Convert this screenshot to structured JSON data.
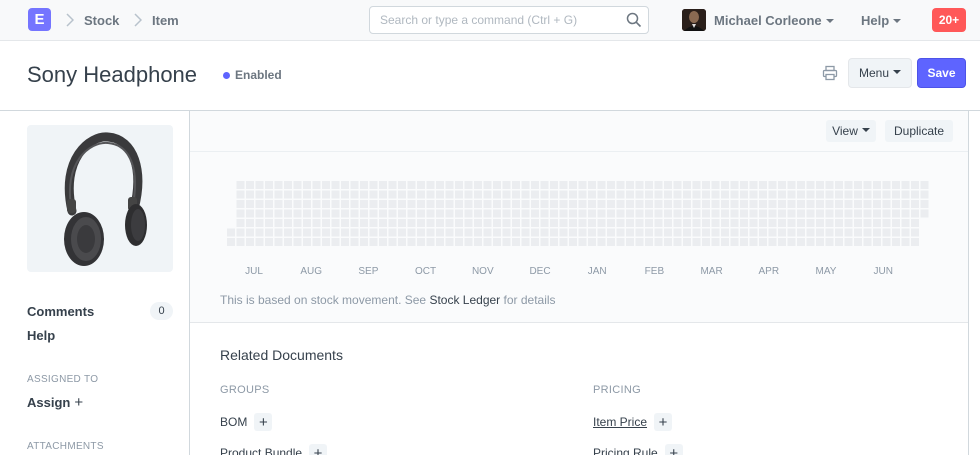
{
  "navbar": {
    "logo_letter": "E",
    "breadcrumbs": [
      "Stock",
      "Item"
    ],
    "search_placeholder": "Search or type a command (Ctrl + G)",
    "user_name": "Michael Corleone",
    "help_label": "Help",
    "notification_count": "20+"
  },
  "page": {
    "title": "Sony Headphone",
    "status": "Enabled",
    "status_color": "#5e64ff",
    "menu_label": "Menu",
    "save_label": "Save"
  },
  "sidebar": {
    "comments_label": "Comments",
    "comments_count": "0",
    "help_label": "Help",
    "assigned_to_label": "ASSIGNED TO",
    "assign_label": "Assign",
    "attachments_label": "ATTACHMENTS"
  },
  "dashboard": {
    "view_label": "View",
    "duplicate_label": "Duplicate",
    "months": [
      "JUL",
      "AUG",
      "SEP",
      "OCT",
      "NOV",
      "DEC",
      "JAN",
      "FEB",
      "MAR",
      "APR",
      "MAY",
      "JUN"
    ],
    "note_prefix": "This is based on stock movement. See",
    "note_link": "Stock Ledger",
    "note_suffix": "for details"
  },
  "related": {
    "title": "Related Documents",
    "groups_label": "GROUPS",
    "pricing_label": "PRICING",
    "groups": [
      "BOM",
      "Product Bundle"
    ],
    "pricing": [
      "Item Price",
      "Pricing Rule"
    ]
  },
  "colors": {
    "accent": "#5e64ff",
    "notification": "#ff5858",
    "heatmap_cell": "#ebedf0"
  }
}
